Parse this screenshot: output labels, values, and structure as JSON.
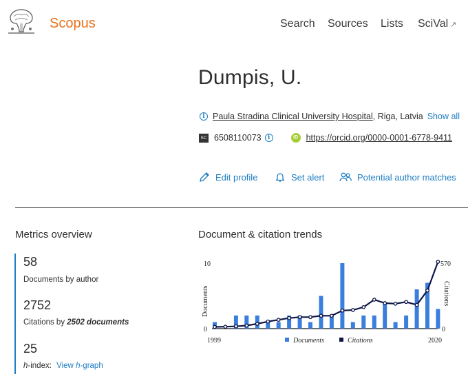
{
  "header": {
    "brand": "Scopus",
    "nav": [
      {
        "label": "Search"
      },
      {
        "label": "Sources"
      },
      {
        "label": "Lists"
      },
      {
        "label": "SciVal",
        "arrow": "↗"
      }
    ]
  },
  "author": {
    "name": "Dumpis, U.",
    "affiliation": {
      "institution": "Paula Stradina Clinical University Hospital",
      "location": ", Riga, Latvia",
      "show_all": "Show all"
    },
    "scopus_id": "6508110073",
    "sc_badge": "SC",
    "orcid_badge": "iD",
    "orcid_url": "https://orcid.org/0000-0001-6778-9411"
  },
  "actions": {
    "edit_profile": "Edit profile",
    "set_alert": "Set alert",
    "author_matches": "Potential author matches"
  },
  "metrics": {
    "title": "Metrics overview",
    "documents_value": "58",
    "documents_label": "Documents by author",
    "citations_value": "2752",
    "citations_label_prefix": "Citations by ",
    "citations_label_docs": "2502 documents",
    "hindex_value": "25",
    "hindex_label_prefix": "h",
    "hindex_label_suffix": "-index:",
    "hindex_link_prefix": "View ",
    "hindex_link_h": "h",
    "hindex_link_suffix": "-graph"
  },
  "trends": {
    "title": "Document & citation trends"
  },
  "colors": {
    "brand": "#e9711c",
    "link": "#1f7ec2",
    "documents_bar": "#3b7fdc",
    "citations_line": "#0e1646"
  },
  "chart_data": {
    "type": "bar",
    "title": "",
    "x": [
      1999,
      2000,
      2001,
      2002,
      2003,
      2004,
      2005,
      2006,
      2007,
      2008,
      2009,
      2010,
      2011,
      2012,
      2013,
      2014,
      2015,
      2016,
      2017,
      2018,
      2019,
      2020
    ],
    "x_tick_labels": [
      "1999",
      "2020"
    ],
    "series": [
      {
        "name": "Documents",
        "axis": "left",
        "style": "bar",
        "values": [
          1,
          0,
          2,
          2,
          2,
          1,
          1,
          2,
          2,
          1,
          5,
          2,
          10,
          1,
          2,
          2,
          4,
          1,
          2,
          6,
          7,
          3
        ]
      },
      {
        "name": "Citations",
        "axis": "right",
        "style": "line",
        "values": [
          3,
          5,
          8,
          15,
          30,
          50,
          65,
          80,
          88,
          88,
          100,
          100,
          145,
          150,
          175,
          240,
          210,
          205,
          220,
          195,
          320,
          570
        ]
      }
    ],
    "ylabel": "Documents",
    "ylabel_right": "Citations",
    "ylim": [
      0,
      10
    ],
    "ylim_right": [
      0,
      570
    ],
    "y_tick_labels": [
      "0",
      "10"
    ],
    "y_right_tick_labels": [
      "0",
      "570"
    ],
    "legend": [
      "Documents",
      "Citations"
    ],
    "legend_position": "bottom",
    "grid": false
  }
}
